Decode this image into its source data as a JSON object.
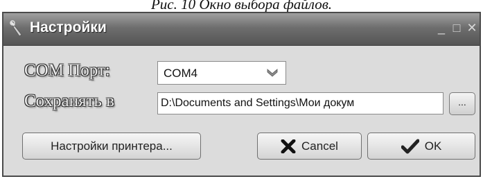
{
  "document": {
    "caption": "Рис. 10 Окно выбора файлов."
  },
  "window": {
    "title": "Настройки",
    "controls": {
      "minimize": "_",
      "maximize": "□",
      "close": "✕"
    }
  },
  "form": {
    "com_port": {
      "label": "COM Порт:",
      "value": "COM4"
    },
    "save_to": {
      "label": "Сохранять в",
      "value": "D:\\Documents and Settings\\Мои докум"
    },
    "browse_label": "..."
  },
  "buttons": {
    "printer_settings": "Настройки принтера...",
    "cancel": "Cancel",
    "ok": "OK"
  },
  "icons": {
    "app": "wrench-icon",
    "dropdown": "chevron-down-icon",
    "cancel": "x-icon",
    "ok": "check-icon"
  },
  "colors": {
    "titlebar": "#6e6e6e",
    "window_bg": "#dcdcdc",
    "cancel_icon": "#111111",
    "ok_icon": "#222222"
  }
}
